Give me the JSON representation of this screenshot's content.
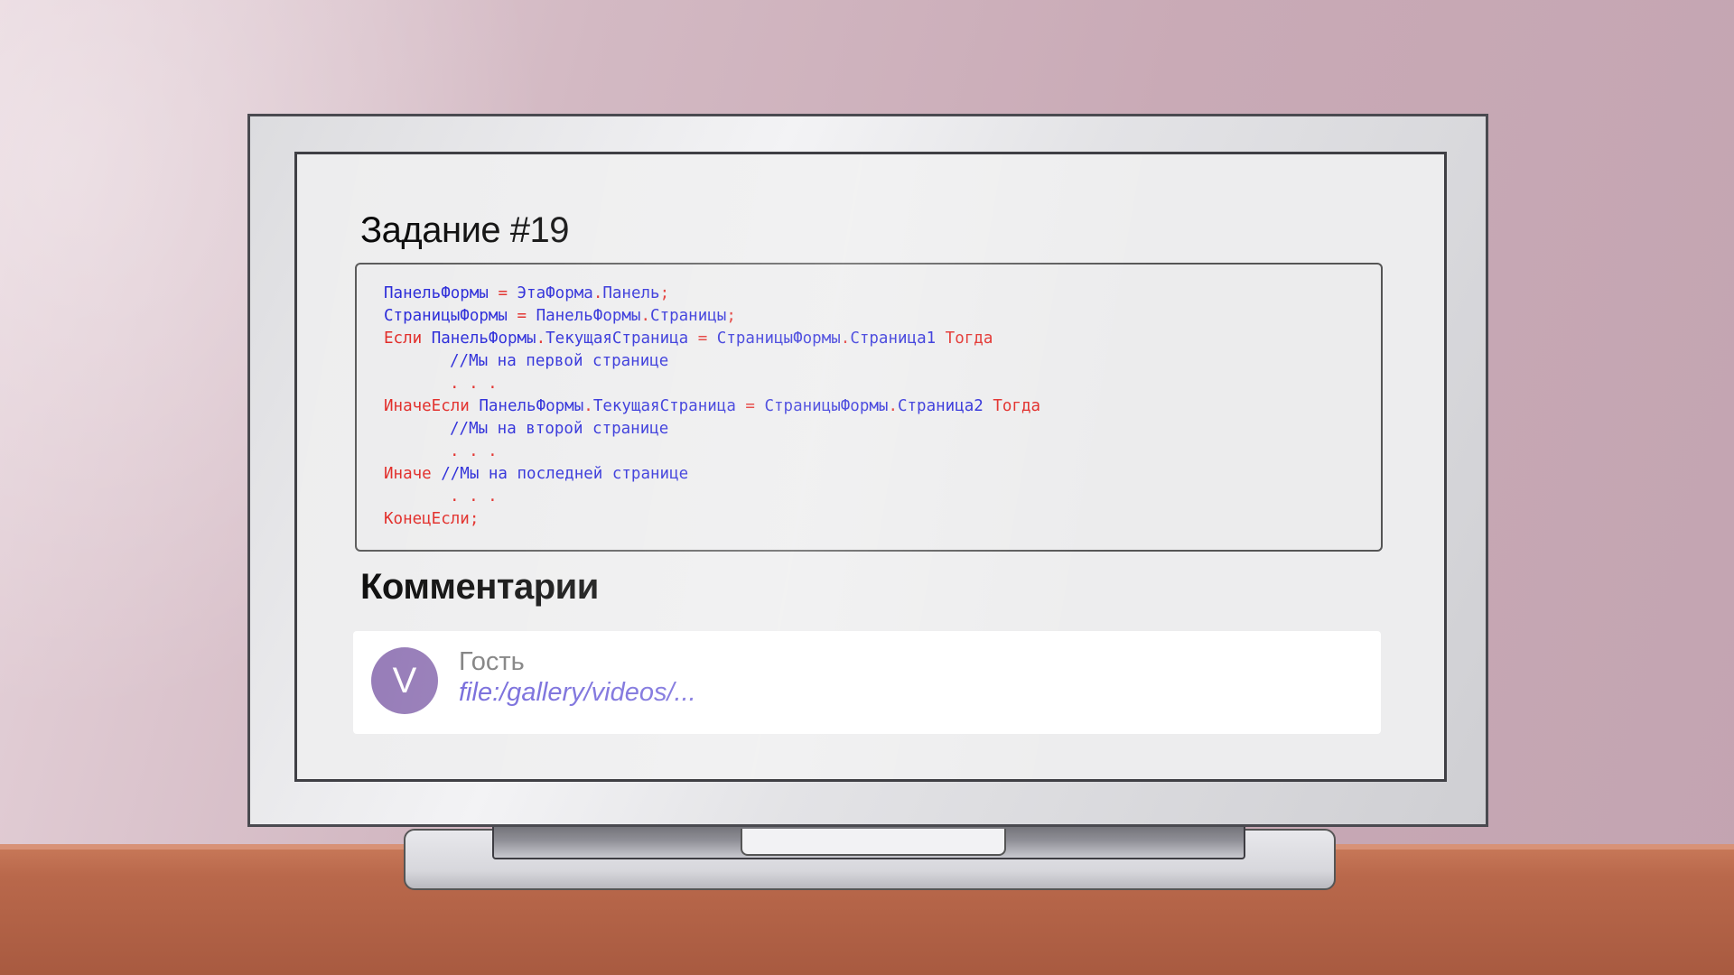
{
  "task": {
    "title": "Задание #19"
  },
  "code": {
    "lines": [
      [
        {
          "t": "ПанельФормы",
          "c": "id"
        },
        {
          "t": " = ",
          "c": "op"
        },
        {
          "t": "ЭтаФорма",
          "c": "id"
        },
        {
          "t": ".",
          "c": "op"
        },
        {
          "t": "Панель",
          "c": "id"
        },
        {
          "t": ";",
          "c": "op"
        }
      ],
      [
        {
          "t": "СтраницыФормы",
          "c": "id"
        },
        {
          "t": " = ",
          "c": "op"
        },
        {
          "t": "ПанельФормы",
          "c": "id"
        },
        {
          "t": ".",
          "c": "op"
        },
        {
          "t": "Страницы",
          "c": "id"
        },
        {
          "t": ";",
          "c": "op"
        }
      ],
      [
        {
          "t": "Если ",
          "c": "kw"
        },
        {
          "t": "ПанельФормы",
          "c": "id"
        },
        {
          "t": ".",
          "c": "op"
        },
        {
          "t": "ТекущаяСтраница",
          "c": "id"
        },
        {
          "t": " = ",
          "c": "op"
        },
        {
          "t": "СтраницыФормы",
          "c": "id"
        },
        {
          "t": ".",
          "c": "op"
        },
        {
          "t": "Страница1",
          "c": "id"
        },
        {
          "t": " Тогда",
          "c": "kw"
        }
      ],
      [
        {
          "t": "",
          "c": "ind"
        },
        {
          "t": "//Мы на первой странице",
          "c": "cm"
        }
      ],
      [
        {
          "t": "",
          "c": "ind"
        },
        {
          "t": ". . .",
          "c": "op"
        }
      ],
      [
        {
          "t": "ИначеЕсли ",
          "c": "kw"
        },
        {
          "t": "ПанельФормы",
          "c": "id"
        },
        {
          "t": ".",
          "c": "op"
        },
        {
          "t": "ТекущаяСтраница",
          "c": "id"
        },
        {
          "t": " = ",
          "c": "op"
        },
        {
          "t": "СтраницыФормы",
          "c": "id"
        },
        {
          "t": ".",
          "c": "op"
        },
        {
          "t": "Страница2",
          "c": "id"
        },
        {
          "t": " Тогда",
          "c": "kw"
        }
      ],
      [
        {
          "t": "",
          "c": "ind"
        },
        {
          "t": "//Мы на второй странице",
          "c": "cm"
        }
      ],
      [
        {
          "t": "",
          "c": "ind"
        },
        {
          "t": ". . .",
          "c": "op"
        }
      ],
      [
        {
          "t": "Иначе ",
          "c": "kw"
        },
        {
          "t": "//Мы на последней странице",
          "c": "cm"
        }
      ],
      [
        {
          "t": "",
          "c": "ind"
        },
        {
          "t": ". . .",
          "c": "op"
        }
      ],
      [
        {
          "t": "КонецЕсли",
          "c": "kw"
        },
        {
          "t": ";",
          "c": "op"
        }
      ]
    ],
    "colors": {
      "keyword": "#e0201c",
      "identifier": "#1d1dd6"
    }
  },
  "comments": {
    "title": "Комментарии",
    "items": [
      {
        "avatar_letter": "V",
        "author": "Гость",
        "link_text": "file:/gallery/videos/...",
        "avatar_color": "#8f73b3"
      }
    ]
  }
}
